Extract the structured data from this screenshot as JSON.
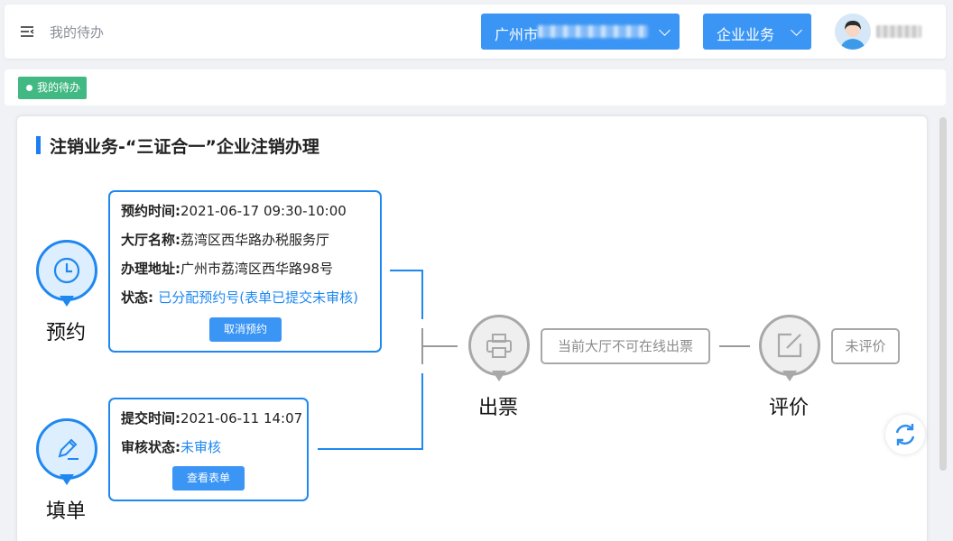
{
  "header": {
    "title": "我的待办",
    "city_label": "广州市",
    "business_label": "企业业务"
  },
  "tags": [
    {
      "label": "我的待办"
    }
  ],
  "card": {
    "title": "注销业务-“三证合一”企业注销办理"
  },
  "steps": {
    "appointment": {
      "label": "预约",
      "time_key": "预约时间:",
      "time_value": "2021-06-17 09:30-10:00",
      "hall_key": "大厅名称:",
      "hall_value": "荔湾区西华路办税服务厅",
      "address_key": "办理地址:",
      "address_value": "广州市荔湾区西华路98号",
      "status_key": "状态: ",
      "status_value": "已分配预约号(表单已提交未审核)",
      "button": "取消预约"
    },
    "form": {
      "label": "填单",
      "time_key": "提交时间:",
      "time_value": "2021-06-11 14:07",
      "review_key": "审核状态:",
      "review_value": "未审核",
      "button": "查看表单"
    },
    "ticket": {
      "label": "出票",
      "note": "当前大厅不可在线出票"
    },
    "evaluate": {
      "label": "评价",
      "note": "未评价"
    }
  },
  "colors": {
    "primary": "#3a95f5",
    "accent_blue": "#1e88f0",
    "tag_green": "#42b983",
    "inactive_gray": "#a8a8a8"
  },
  "icons": [
    "menu-fold-icon",
    "chevron-down-icon",
    "clock-icon",
    "pen-edit-icon",
    "printer-icon",
    "edit-square-icon",
    "refresh-icon"
  ]
}
